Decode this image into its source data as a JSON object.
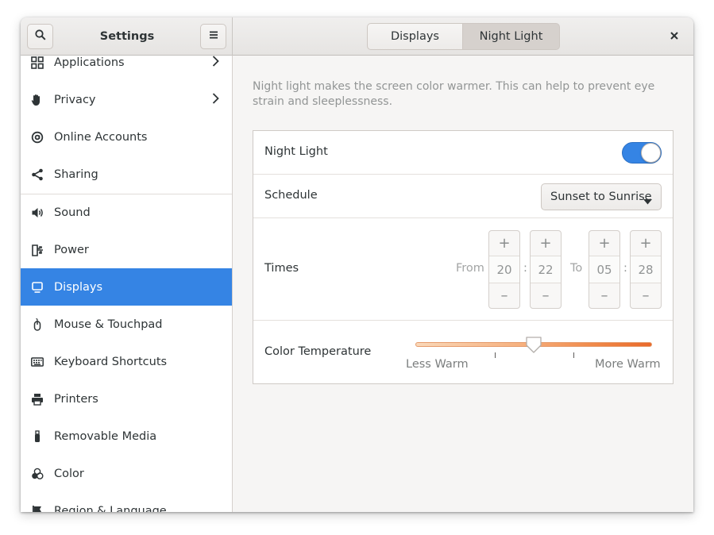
{
  "header": {
    "app_title": "Settings",
    "tabs": [
      {
        "label": "Displays",
        "active": false
      },
      {
        "label": "Night Light",
        "active": true
      }
    ],
    "search_icon": "search-icon",
    "menu_icon": "hamburger-menu-icon",
    "close_icon": "close-icon"
  },
  "sidebar": {
    "selected_color": "#3584e4",
    "items": [
      {
        "label": "Applications",
        "icon": "applications-grid-icon",
        "chevron": true
      },
      {
        "label": "Privacy",
        "icon": "privacy-hand-icon",
        "chevron": true
      },
      {
        "label": "Online Accounts",
        "icon": "at-sign-icon",
        "chevron": false
      },
      {
        "label": "Sharing",
        "icon": "share-icon",
        "chevron": false
      },
      {
        "label": "Sound",
        "icon": "speaker-icon",
        "chevron": false
      },
      {
        "label": "Power",
        "icon": "power-plug-icon",
        "chevron": false
      },
      {
        "label": "Displays",
        "icon": "monitor-icon",
        "chevron": false,
        "selected": true
      },
      {
        "label": "Mouse & Touchpad",
        "icon": "mouse-icon",
        "chevron": false
      },
      {
        "label": "Keyboard Shortcuts",
        "icon": "keyboard-icon",
        "chevron": false
      },
      {
        "label": "Printers",
        "icon": "printer-icon",
        "chevron": false
      },
      {
        "label": "Removable Media",
        "icon": "usb-drive-icon",
        "chevron": false
      },
      {
        "label": "Color",
        "icon": "color-circles-icon",
        "chevron": false
      },
      {
        "label": "Region & Language",
        "icon": "flag-icon",
        "chevron": false
      }
    ]
  },
  "night_light": {
    "description": "Night light makes the screen color warmer. This can help to prevent eye strain and sleeplessness.",
    "toggle_label": "Night Light",
    "toggle_on": true,
    "schedule_label": "Schedule",
    "schedule_value": "Sunset to Sunrise",
    "times_label": "Times",
    "from_label": "From",
    "to_label": "To",
    "from_hour": "20",
    "from_minute": "22",
    "to_hour": "05",
    "to_minute": "28",
    "colon": ":",
    "plus": "+",
    "minus": "–",
    "temperature_label": "Color Temperature",
    "less_warm_label": "Less Warm",
    "more_warm_label": "More Warm",
    "temperature_fraction": 0.5
  }
}
